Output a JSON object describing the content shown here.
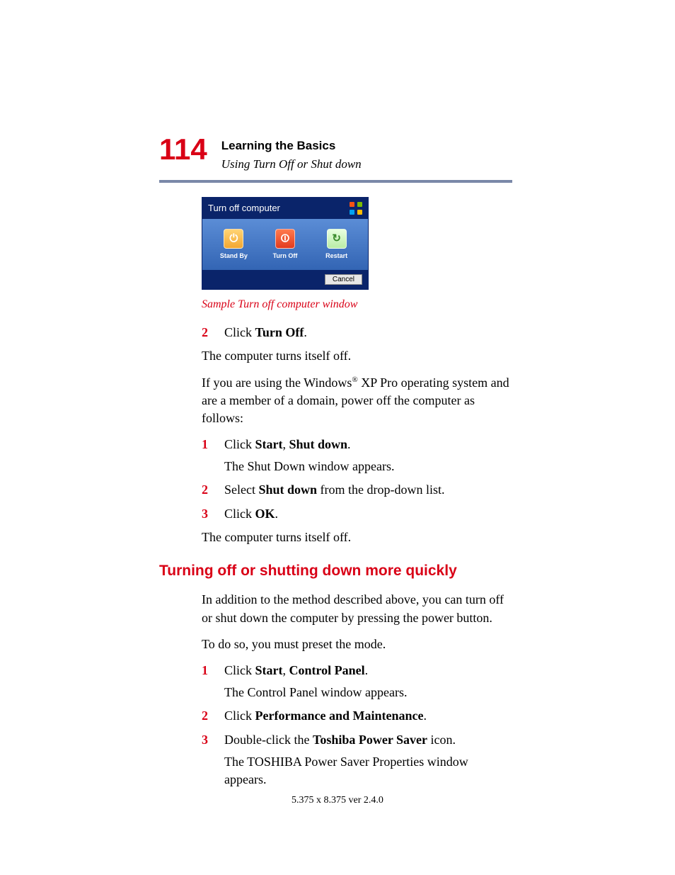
{
  "page_number": "114",
  "header": {
    "chapter": "Learning the Basics",
    "section": "Using Turn Off or Shut down"
  },
  "dialog": {
    "title": "Turn off computer",
    "options": {
      "standby": "Stand By",
      "turnoff": "Turn Off",
      "restart": "Restart"
    },
    "cancel": "Cancel"
  },
  "caption": "Sample Turn off computer window",
  "step2": {
    "num": "2",
    "click": "Click ",
    "target": "Turn Off",
    "period": "."
  },
  "para_turnsoff1": "The computer turns itself off.",
  "para_xp_1": "If you are using the Windows",
  "para_xp_reg": "®",
  "para_xp_2": " XP Pro operating system and are a member of a domain, power off the computer as follows:",
  "stepsA": {
    "s1": {
      "num": "1",
      "pre": "Click ",
      "b1": "Start",
      "sep": ", ",
      "b2": "Shut down",
      "suf": ".",
      "sub": "The Shut Down window appears."
    },
    "s2": {
      "num": "2",
      "pre": "Select ",
      "b1": "Shut down",
      "suf": " from the drop-down list."
    },
    "s3": {
      "num": "3",
      "pre": "Click ",
      "b1": "OK",
      "suf": "."
    }
  },
  "para_turnsoff2": "The computer turns itself off.",
  "h2": "Turning off or shutting down more quickly",
  "para_addl": "In addition to the method described above, you can turn off or shut down the computer by pressing the power button.",
  "para_preset": "To do so, you must preset the mode.",
  "stepsB": {
    "s1": {
      "num": "1",
      "pre": "Click ",
      "b1": "Start",
      "sep": ", ",
      "b2": "Control Panel",
      "suf": ".",
      "sub": "The Control Panel window appears."
    },
    "s2": {
      "num": "2",
      "pre": "Click ",
      "b1": "Performance and Maintenance",
      "suf": "."
    },
    "s3": {
      "num": "3",
      "pre": "Double-click the ",
      "b1": "Toshiba Power Saver",
      "suf": " icon.",
      "sub": "The TOSHIBA Power Saver Properties window appears."
    }
  },
  "footer": "5.375 x 8.375 ver 2.4.0"
}
